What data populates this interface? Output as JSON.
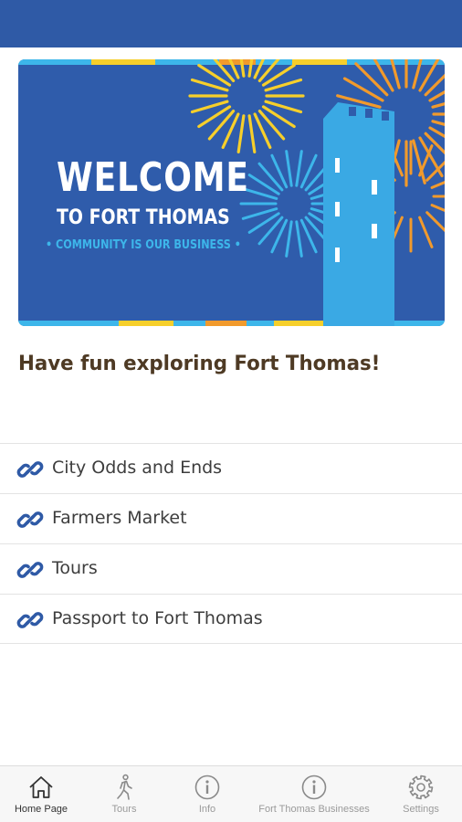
{
  "banner": {
    "title": "WELCOME",
    "subtitle": "TO FORT THOMAS",
    "tagline": "• COMMUNITY IS OUR BUSINESS •"
  },
  "headline": "Have fun exploring Fort Thomas!",
  "links": [
    {
      "label": "City Odds and Ends",
      "icon": "link-icon"
    },
    {
      "label": "Farmers Market",
      "icon": "link-icon"
    },
    {
      "label": "Tours",
      "icon": "link-icon"
    },
    {
      "label": "Passport to Fort Thomas",
      "icon": "link-icon"
    }
  ],
  "tabs": [
    {
      "label": "Home Page",
      "icon": "home-icon",
      "active": true
    },
    {
      "label": "Tours",
      "icon": "walking-icon",
      "active": false
    },
    {
      "label": "Info",
      "icon": "info-icon",
      "active": false
    },
    {
      "label": "Fort Thomas Businesses",
      "icon": "info-icon",
      "active": false
    },
    {
      "label": "Settings",
      "icon": "gear-icon",
      "active": false
    }
  ],
  "colors": {
    "header": "#2f5aa6",
    "banner_bg": "#2f5cab",
    "tower": "#3aa9e4",
    "link_icon": "#2f5aa6",
    "headline": "#4e3a24"
  }
}
